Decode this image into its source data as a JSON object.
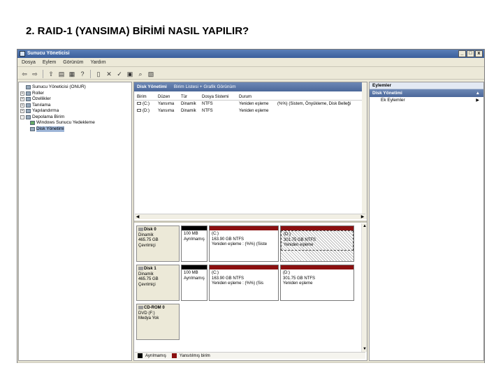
{
  "slide_title": "2. RAID-1 (YANSIMA) BİRİMİ NASIL YAPILIR?",
  "window": {
    "title": "Sunucu Yöneticisi",
    "controls": [
      "_",
      "□",
      "x"
    ]
  },
  "menu": [
    "Dosya",
    "Eylem",
    "Görünüm",
    "Yardım"
  ],
  "tree": [
    {
      "label": "Sunucu Yöneticisi (ONUR)",
      "exp": "",
      "indent": 0
    },
    {
      "label": "Roller",
      "exp": "+",
      "indent": 1
    },
    {
      "label": "Özellikler",
      "exp": "+",
      "indent": 1
    },
    {
      "label": "Tanılama",
      "exp": "+",
      "indent": 1
    },
    {
      "label": "Yapılandırma",
      "exp": "+",
      "indent": 1
    },
    {
      "label": "Depolama Birim",
      "exp": "-",
      "indent": 1
    },
    {
      "label": "Windows Sunucu Yedekleme",
      "exp": "",
      "indent": 2
    },
    {
      "label": "Disk Yönetimi",
      "exp": "",
      "indent": 2,
      "selected": true
    }
  ],
  "center": {
    "title": "Disk Yönetimi",
    "subtitle": "Birim Listesi + Grafik Görünüm",
    "columns": [
      "Birim",
      "Düzen",
      "Tür",
      "Dosya Sistemi",
      "Durum",
      ""
    ],
    "rows": [
      [
        "(C:)",
        "Yansıma",
        "Dinamik",
        "NTFS",
        "Yeniden eşleme",
        "(%%) (Sistem, Önyükleme, Disk Belleği"
      ],
      [
        "(D:)",
        "Yansıma",
        "Dinamik",
        "NTFS",
        "Yeniden eşleme",
        ""
      ]
    ]
  },
  "disks": [
    {
      "name": "Disk 0",
      "type": "Dinamik",
      "size": "465.75 GB",
      "status": "Çevrimiçi",
      "partitions": [
        {
          "line1": "",
          "line2": "100 MB",
          "line3": "Ayrılmamış",
          "bar": "unalloc"
        },
        {
          "line1": "(C:)",
          "line2": "163.90 GB NTFS",
          "line3": "Yeniden eşleme : (%%) (Siste",
          "bar": "mirror"
        },
        {
          "line1": "(D:)",
          "line2": "301.75 GB NTFS",
          "line3": "Yeniden eşleme",
          "bar": "mirror",
          "hatched": true
        }
      ]
    },
    {
      "name": "Disk 1",
      "type": "Dinamik",
      "size": "465.75 GB",
      "status": "Çevrimiçi",
      "partitions": [
        {
          "line1": "",
          "line2": "100 MB",
          "line3": "Ayrılmamış",
          "bar": "unalloc"
        },
        {
          "line1": "(C:)",
          "line2": "163.90 GB NTFS",
          "line3": "Yeniden eşleme : (%%) (Sis",
          "bar": "mirror"
        },
        {
          "line1": "(D:)",
          "line2": "301.75 GB NTFS",
          "line3": "Yeniden eşleme",
          "bar": "mirror"
        }
      ]
    },
    {
      "name": "CD-ROM 0",
      "type": "DVD (F:)",
      "size": "",
      "status": "Medya Yok",
      "partitions": []
    }
  ],
  "legend": [
    {
      "label": "Ayrılmamış",
      "color": "#000000"
    },
    {
      "label": "Yansıtılmış birim",
      "color": "#8b1010"
    }
  ],
  "actions": {
    "header": "Eylemler",
    "section": "Disk Yönetimi",
    "section_caret": "▲",
    "items": [
      {
        "label": "Ek Eylemler",
        "arrow": "▶"
      }
    ]
  }
}
